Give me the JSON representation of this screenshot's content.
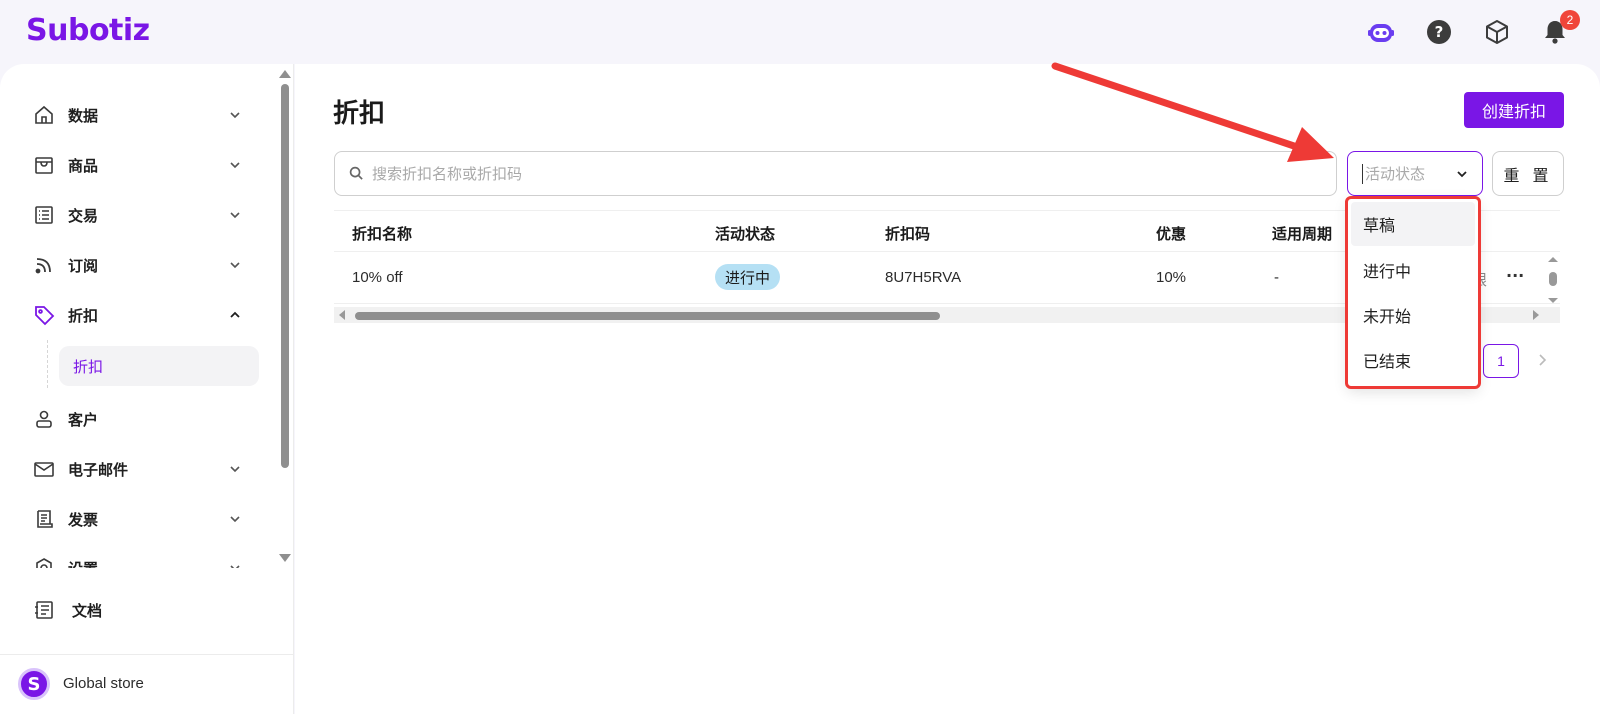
{
  "app": {
    "logo_text": "Subotiz",
    "notification_count": "2",
    "brand_color": "#7a16e6"
  },
  "header_icons": [
    "robot-assistant-icon",
    "help-icon",
    "box-icon",
    "bell-icon"
  ],
  "sidebar": {
    "items": [
      {
        "label": "数据",
        "icon": "home-icon",
        "expandable": true
      },
      {
        "label": "商品",
        "icon": "store-icon",
        "expandable": true
      },
      {
        "label": "交易",
        "icon": "list-icon",
        "expandable": true
      },
      {
        "label": "订阅",
        "icon": "rss-icon",
        "expandable": true
      },
      {
        "label": "折扣",
        "icon": "tag-icon",
        "expandable": true,
        "expanded": true
      },
      {
        "label": "客户",
        "icon": "user-icon",
        "expandable": false
      },
      {
        "label": "电子邮件",
        "icon": "mail-icon",
        "expandable": true
      },
      {
        "label": "发票",
        "icon": "invoice-icon",
        "expandable": true
      },
      {
        "label": "设置",
        "icon": "settings-icon",
        "expandable": true
      }
    ],
    "sub_item": "折扣",
    "docs_label": "文档",
    "store_name": "Global store",
    "store_initial": "S"
  },
  "main": {
    "title": "折扣",
    "create_button": "创建折扣",
    "search_placeholder": "搜索折扣名称或折扣码",
    "status_placeholder": "活动状态",
    "reset_button": "重 置"
  },
  "table": {
    "columns": [
      "折扣名称",
      "活动状态",
      "折扣码",
      "优惠",
      "适用周期"
    ],
    "rows": [
      {
        "name": "10% off",
        "status": "进行中",
        "code": "8U7H5RVA",
        "discount": "10%",
        "period": "-",
        "cut_text": "限"
      }
    ]
  },
  "pagination": {
    "current": "1"
  },
  "dropdown": {
    "options": [
      "草稿",
      "进行中",
      "未开始",
      "已结束"
    ],
    "hovered_index": 0
  }
}
